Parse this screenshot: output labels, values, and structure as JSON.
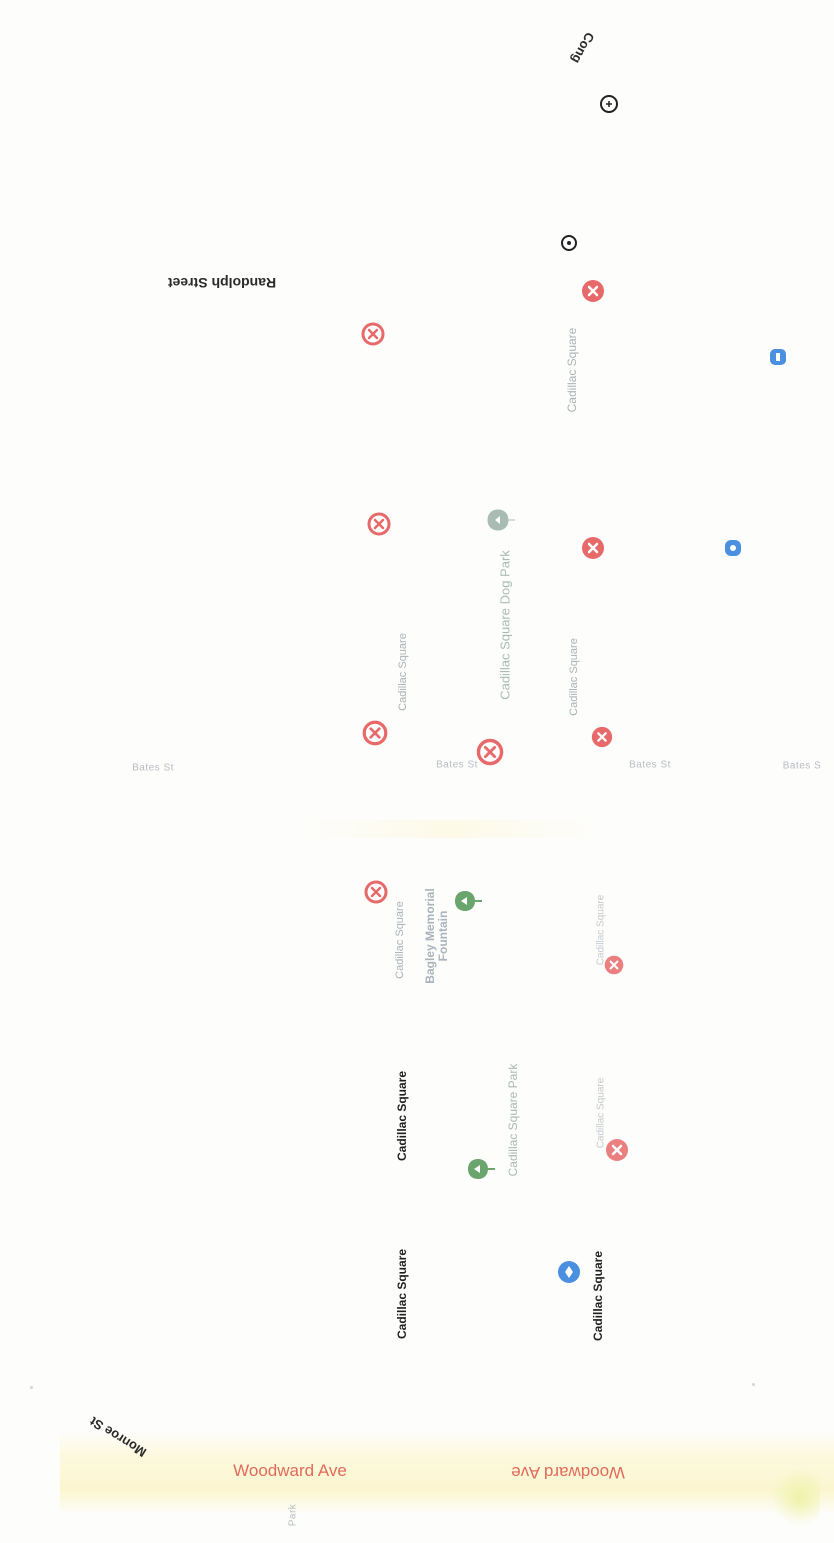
{
  "map": {
    "streets": {
      "randolph": "Randolph Street",
      "woodward_a": "Woodward Ave",
      "woodward_b": "Woodward Ave",
      "monroe": "Monroe St",
      "bates_1": "Bates St",
      "bates_2": "Bates St",
      "bates_3": "Bates St",
      "bates_4": "Bates S",
      "congress": "Cong",
      "park": "Park"
    },
    "places": {
      "cadillac_square_1": "Cadillac Square",
      "cadillac_square_2": "Cadillac Square",
      "cadillac_square_3": "Cadillac Square",
      "cadillac_square_4": "Cadillac Square",
      "cadillac_square_5": "Cadillac Square",
      "cadillac_square_6": "Cadillac Square",
      "cadillac_square_7": "Cadillac Square",
      "cadillac_square_8": "Cadillac Square",
      "cadillac_square_9": "Cadillac Square",
      "dog_park": "Cadillac Square Dog Park",
      "fountain": "Bagley Memorial Fountain",
      "park": "Cadillac Square Park"
    },
    "icons": {
      "transit": "bus-stop-icon",
      "park": "park-pin-icon",
      "info": "info-icon"
    },
    "colors": {
      "transit": "#e8696a",
      "park": "#6aa56d",
      "dog_park": "#a9bcb4",
      "info": "#4a8fe0",
      "woodward": "#e06b5c",
      "road_band": "#fdf9de"
    }
  }
}
